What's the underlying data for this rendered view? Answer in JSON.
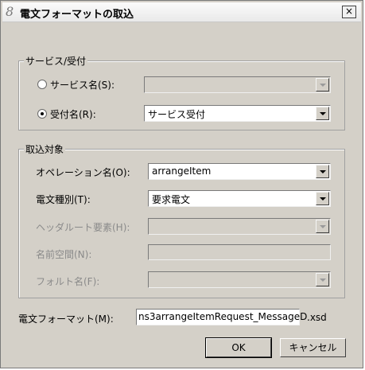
{
  "window": {
    "title": "電文フォーマットの取込",
    "close_label": "×"
  },
  "service_group": {
    "title": "サービス/受付",
    "service_name_label": "サービス名(S):",
    "service_name_value": "",
    "reception_name_label": "受付名(R):",
    "reception_name_value": "サービス受付",
    "selected": "reception"
  },
  "target_group": {
    "title": "取込対象",
    "operation_label": "オペレーション名(O):",
    "operation_value": "arrangeItem",
    "message_type_label": "電文種別(T):",
    "message_type_value": "要求電文",
    "header_root_label": "ヘッダルート要素(H):",
    "header_root_value": "",
    "namespace_label": "名前空間(N):",
    "namespace_value": "",
    "fault_name_label": "フォルト名(F):",
    "fault_name_value": ""
  },
  "format": {
    "label": "電文フォーマット(M):",
    "value": "ns3arrangeItemRequest_MessageD",
    "extension": ".xsd"
  },
  "buttons": {
    "ok": "OK",
    "cancel": "キャンセル"
  }
}
